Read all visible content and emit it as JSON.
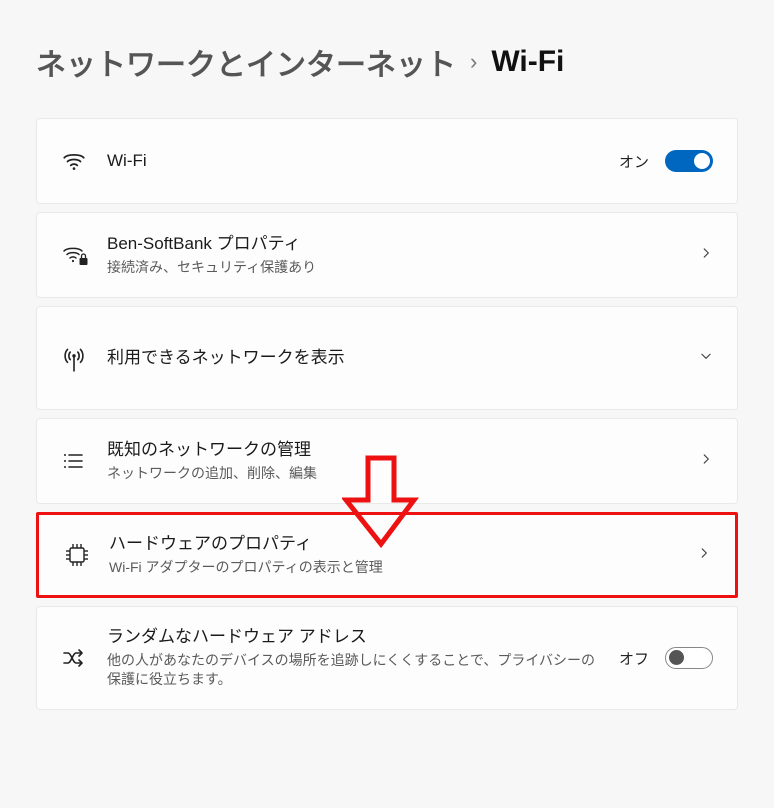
{
  "breadcrumb": {
    "parent": "ネットワークとインターネット",
    "separator": "›",
    "current": "Wi-Fi"
  },
  "cards": {
    "wifi_toggle": {
      "title": "Wi-Fi",
      "state_label": "オン",
      "state": "on"
    },
    "current_network": {
      "title": "Ben-SoftBank プロパティ",
      "subtitle": "接続済み、セキュリティ保護あり"
    },
    "available_networks": {
      "title": "利用できるネットワークを表示"
    },
    "known_networks": {
      "title": "既知のネットワークの管理",
      "subtitle": "ネットワークの追加、削除、編集"
    },
    "hardware_props": {
      "title": "ハードウェアのプロパティ",
      "subtitle": "Wi-Fi アダプターのプロパティの表示と管理"
    },
    "random_hw": {
      "title": "ランダムなハードウェア アドレス",
      "subtitle": "他の人があなたのデバイスの場所を追跡しにくくすることで、プライバシーの保護に役立ちます。",
      "state_label": "オフ",
      "state": "off"
    }
  },
  "annotation": {
    "highlight_card": "hardware_props",
    "arrow_color": "#e11"
  }
}
